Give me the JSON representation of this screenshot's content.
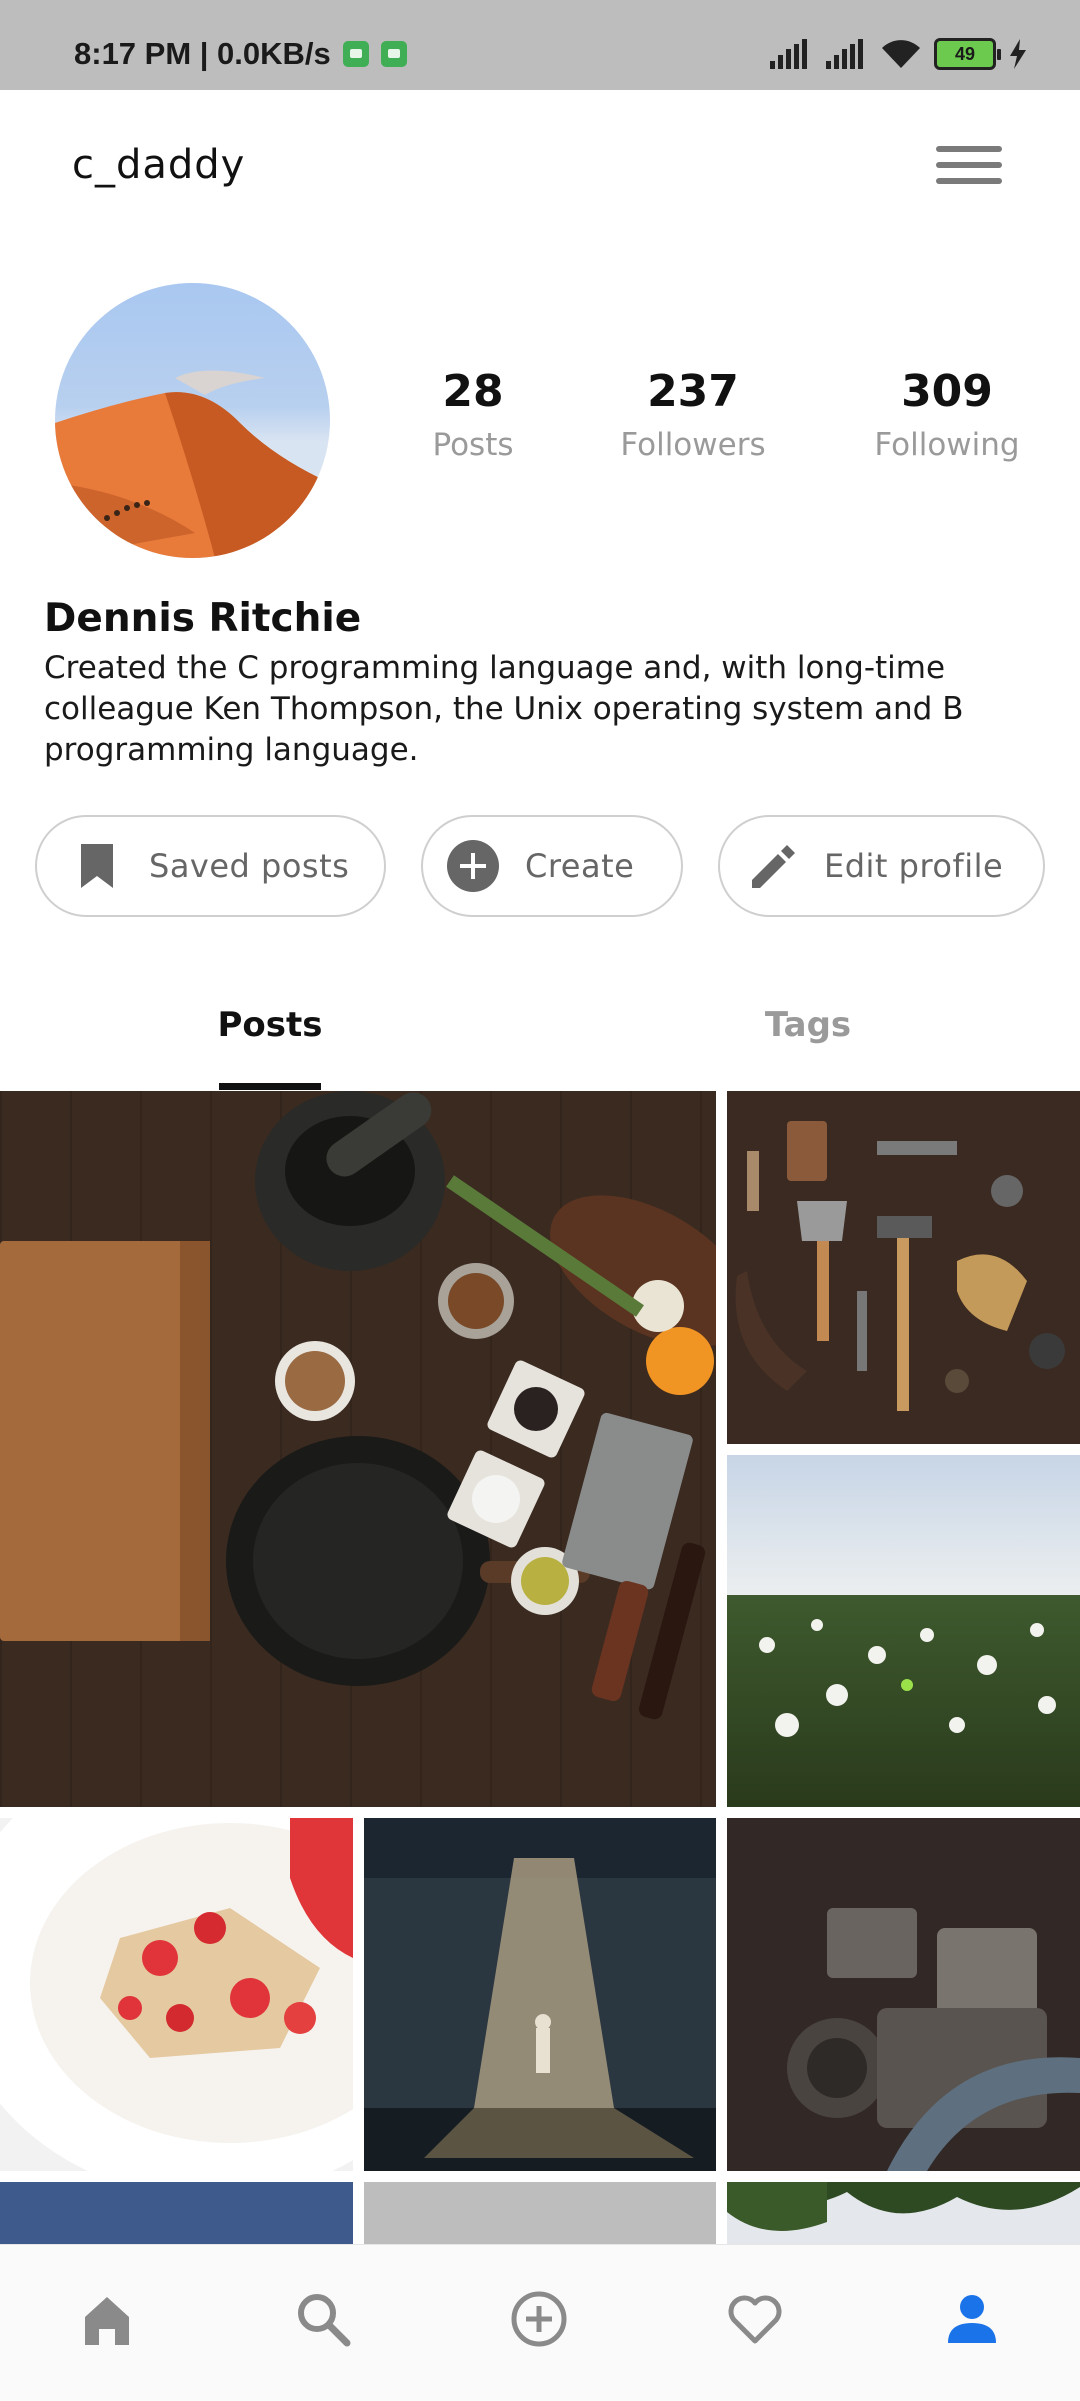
{
  "status_bar": {
    "time_text": "8:17 PM | 0.0KB/s",
    "battery_level": "49"
  },
  "header": {
    "username": "c_daddy",
    "menu_icon": "hamburger-icon"
  },
  "profile": {
    "stats": [
      {
        "value": "28",
        "label": "Posts"
      },
      {
        "value": "237",
        "label": "Followers"
      },
      {
        "value": "309",
        "label": "Following"
      }
    ],
    "name": "Dennis Ritchie",
    "bio": "Created the C programming language and, with long-time colleague Ken Thompson, the Unix operating system and B programming language."
  },
  "actions": {
    "saved": {
      "label": "Saved posts",
      "icon": "bookmark-icon"
    },
    "create": {
      "label": "Create",
      "icon": "add-circle-icon"
    },
    "edit": {
      "label": "Edit profile",
      "icon": "pencil-icon"
    }
  },
  "tabs": [
    {
      "label": "Posts",
      "active": true
    },
    {
      "label": "Tags",
      "active": false
    }
  ],
  "bottom_nav": [
    {
      "icon": "home-icon",
      "active": false
    },
    {
      "icon": "search-icon",
      "active": false
    },
    {
      "icon": "add-circle-icon",
      "active": false
    },
    {
      "icon": "heart-icon",
      "active": false
    },
    {
      "icon": "profile-icon",
      "active": true
    }
  ],
  "colors": {
    "accent": "#1a73e8",
    "inactive_icon": "#8a8a8a",
    "status_bar_bg": "#bdbdbd"
  }
}
